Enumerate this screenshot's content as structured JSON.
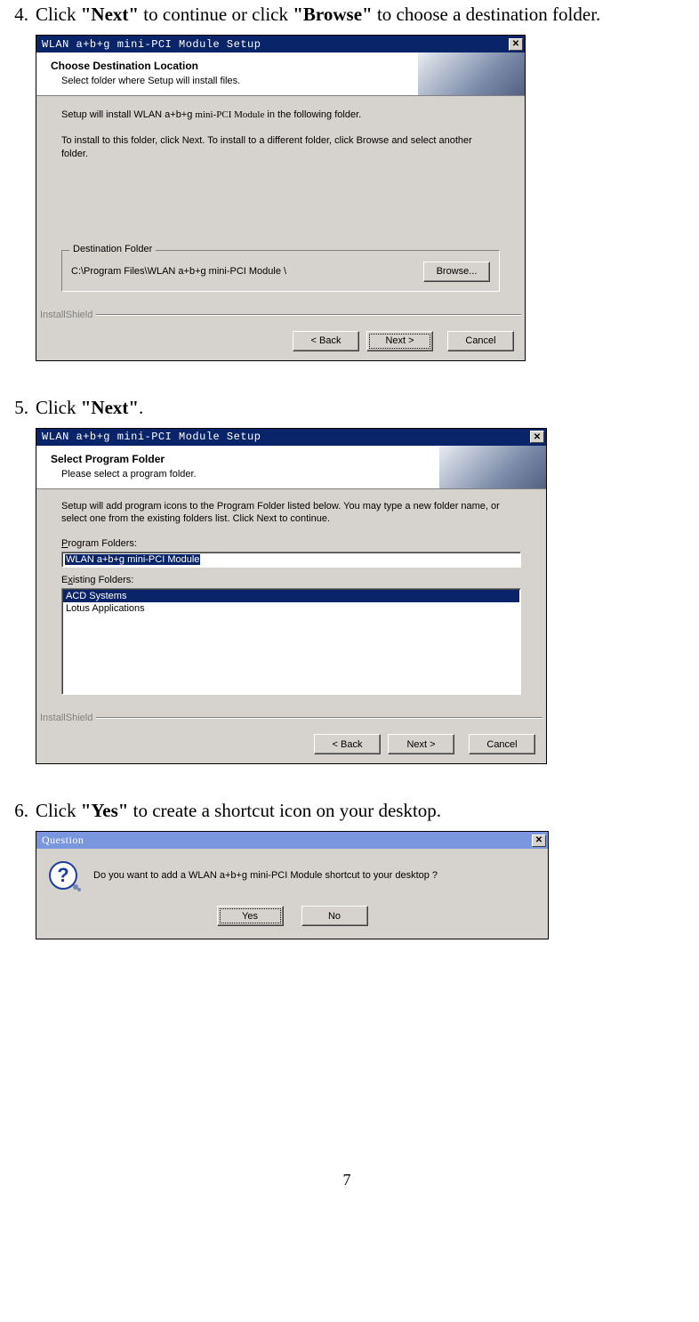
{
  "steps": {
    "s4": {
      "num": "4.",
      "pre": "Click ",
      "b1": "\"Next\"",
      "mid": " to continue or click ",
      "b2": "\"Browse\"",
      "post": " to choose a destination folder."
    },
    "s5": {
      "num": "5.",
      "pre": "Click ",
      "b1": "\"Next\"",
      "post": "."
    },
    "s6": {
      "num": "6.",
      "pre": "Click ",
      "b1": "\"Yes\"",
      "post": " to create a shortcut icon on your desktop."
    }
  },
  "dlg1": {
    "title": "WLAN a+b+g mini-PCI Module Setup",
    "hdr1": "Choose Destination Location",
    "hdr2": "Select folder where Setup will install files.",
    "p1a": "Setup will install WLAN a+b+g ",
    "p1b": "mini-PCI Module",
    "p1c": " in the following folder.",
    "p2": "To install to this folder, click Next. To install to a different folder, click Browse and select another folder.",
    "group": "Destination Folder",
    "path_a": "C:\\Program Files\\WLAN a+b+g ",
    "path_b": "mini-PCI Module",
    "path_c": " \\",
    "browse": "Browse...",
    "brand": "InstallShield",
    "back": "< Back",
    "next": "Next >",
    "cancel": "Cancel"
  },
  "dlg2": {
    "title": "WLAN a+b+g mini-PCI Module Setup",
    "hdr1": "Select Program Folder",
    "hdr2": "Please select a program folder.",
    "p1": "Setup will add program icons to the Program Folder listed below.  You may type a new folder name, or select one from the existing folders list.  Click Next to continue.",
    "lblPF": "Program Folders:",
    "pf_a": "WLAN a+b+g ",
    "pf_b": "mini-PCI Module",
    "lblEF": "Existing Folders:",
    "ef": [
      "ACD Systems",
      "Lotus Applications"
    ],
    "brand": "InstallShield",
    "back": "< Back",
    "next": "Next >",
    "cancel": "Cancel"
  },
  "dlg3": {
    "title": "Question",
    "msg_a": "Do you want to add a WLAN a+b+g ",
    "msg_b": "mini-PCI Module",
    "msg_c": " shortcut to your desktop ?",
    "yes": "Yes",
    "no": "No"
  },
  "pageNum": "7"
}
